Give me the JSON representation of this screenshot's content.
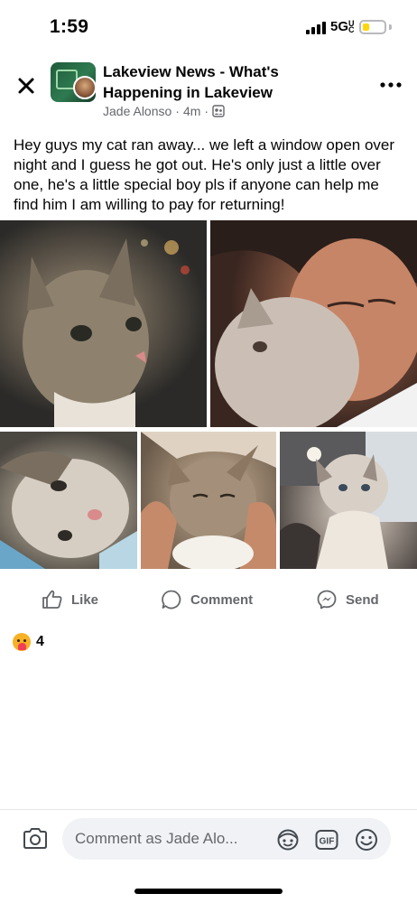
{
  "status_bar": {
    "time": "1:59",
    "network": "5G",
    "network_sub": "UC",
    "battery_color": "#ffd60a"
  },
  "post": {
    "group_name": "Lakeview News - What's Happening in Lakeview",
    "author": "Jade Alonso",
    "timestamp": "4m",
    "separator": "·",
    "privacy_icon": "group-members-icon",
    "text": "Hey guys my cat ran away... we left a window open over night and I guess he got out. He's only just a little over one, he's a little special boy pls if anyone can help me find him I am willing to pay for returning!",
    "photos_count": 5
  },
  "actions": {
    "like_label": "Like",
    "comment_label": "Comment",
    "send_label": "Send",
    "text_color": "#65676b"
  },
  "reactions": {
    "emoji": "care-emoji",
    "count": "4"
  },
  "composer": {
    "placeholder": "Comment as Jade Alo...",
    "gif_label": "GIF"
  }
}
